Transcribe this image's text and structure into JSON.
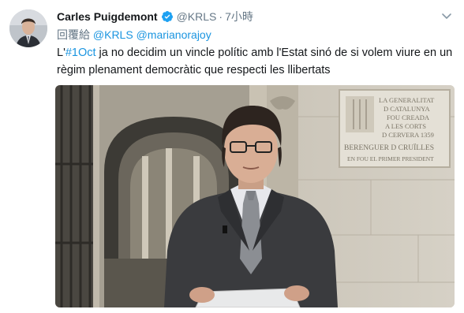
{
  "tweet": {
    "author": {
      "display_name": "Carles Puigdemont",
      "handle": "@KRLS",
      "verified": true
    },
    "separator": "·",
    "timestamp": "7小時",
    "reply": {
      "prefix": "回覆給",
      "mentions": [
        "@KRLS",
        "@marianorajoy"
      ]
    },
    "text": {
      "prefix": "L'",
      "hashtag": "#1Oct",
      "body": " ja no decidim un vincle polític amb l'Estat sinó de si volem viure en un règim plenament democràtic que respecti les llibertats"
    },
    "media": {
      "type": "video",
      "plaque_lines": [
        "LA GENERALITAT",
        "D CATALUNYA",
        "FOU CREADA",
        "A LES CORTS",
        "D CERVERA 1359",
        "BERENGUER D CRUÏLLES",
        "EN FOU EL PRIMER PRESIDENT"
      ]
    }
  },
  "colors": {
    "link": "#1b95e0",
    "secondary_text": "#657786",
    "verified": "#1da1f2"
  },
  "icons": {
    "verified": "verified-badge-icon",
    "menu": "chevron-down-icon"
  }
}
